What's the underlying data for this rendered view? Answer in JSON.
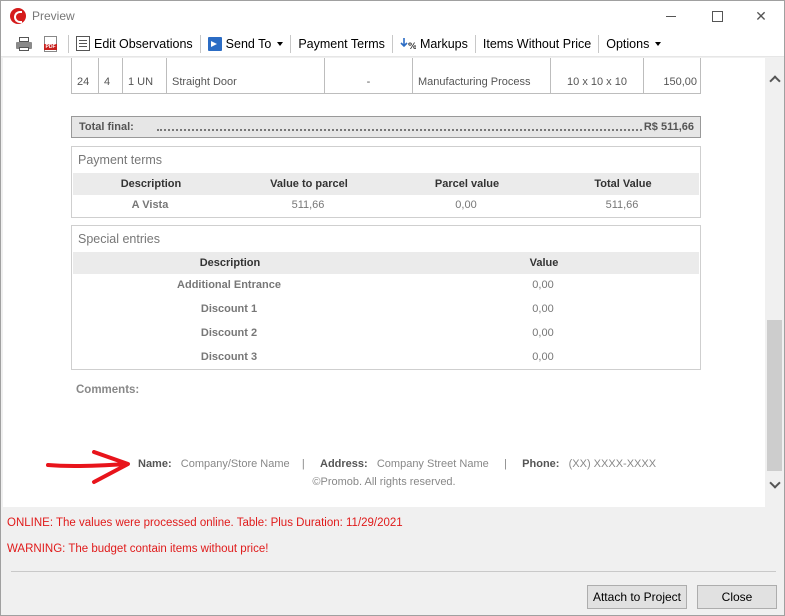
{
  "window": {
    "title": "Preview"
  },
  "toolbar": {
    "edit_observations": "Edit Observations",
    "send_to": "Send To",
    "payment_terms": "Payment Terms",
    "markups": "Markups",
    "items_without_price": "Items Without Price",
    "options": "Options"
  },
  "item_row": {
    "cells": [
      "24",
      "4",
      "1 UN",
      "Straight Door",
      "-",
      "Manufacturing Process",
      "10 x 10 x 10",
      "150,00"
    ]
  },
  "total": {
    "label": "Total final:",
    "value": "R$ 511,66"
  },
  "payment_terms": {
    "title": "Payment terms",
    "headers": [
      "Description",
      "Value to parcel",
      "Parcel value",
      "Total Value"
    ],
    "rows": [
      [
        "A Vista",
        "511,66",
        "0,00",
        "511,66"
      ]
    ]
  },
  "special_entries": {
    "title": "Special entries",
    "headers": [
      "Description",
      "Value"
    ],
    "rows": [
      [
        "Additional Entrance",
        "0,00"
      ],
      [
        "Discount 1",
        "0,00"
      ],
      [
        "Discount 2",
        "0,00"
      ],
      [
        "Discount 3",
        "0,00"
      ]
    ]
  },
  "comments": {
    "label": "Comments:"
  },
  "footer": {
    "name_label": "Name:",
    "name_value": "Company/Store Name",
    "address_label": "Address:",
    "address_value": "Company Street Name",
    "phone_label": "Phone:",
    "phone_value": "(XX) XXXX-XXXX",
    "separator": "|",
    "copyright": "©Promob. All rights reserved."
  },
  "messages": {
    "online": "ONLINE: The values were processed online. Table: Plus Duration: 11/29/2021",
    "warning": "WARNING: The budget contain items without price!"
  },
  "buttons": {
    "attach": "Attach to Project",
    "close": "Close"
  },
  "colors": {
    "message_red": "#e01b1b",
    "arrow_red": "#e8141b"
  }
}
